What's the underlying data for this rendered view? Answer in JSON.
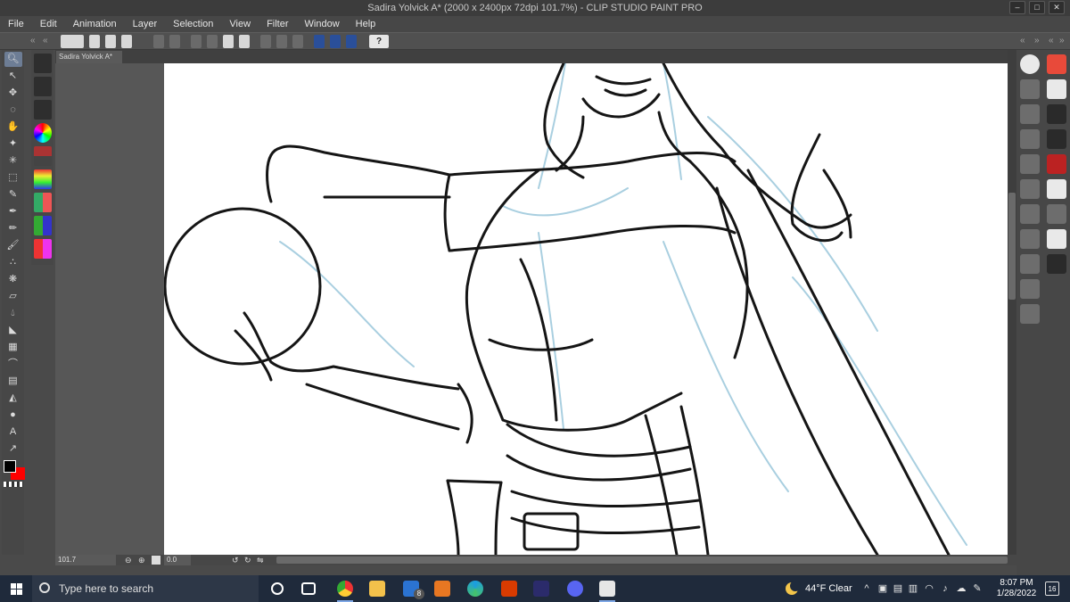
{
  "window": {
    "title": "Sadira Yolvick A* (2000 x 2400px 72dpi 101.7%)  - CLIP STUDIO PAINT PRO",
    "controls": [
      "minimize-icon",
      "maximize-icon",
      "close-icon"
    ]
  },
  "menu": {
    "items": [
      {
        "label": "File"
      },
      {
        "label": "Edit"
      },
      {
        "label": "Animation"
      },
      {
        "label": "Layer"
      },
      {
        "label": "Selection"
      },
      {
        "label": "View"
      },
      {
        "label": "Filter"
      },
      {
        "label": "Window"
      },
      {
        "label": "Help"
      }
    ]
  },
  "command_bar": {
    "help_label": "?"
  },
  "document": {
    "tab_label": "Sadira Yolvick A*"
  },
  "status": {
    "zoom": "101.7",
    "rotation": "0.0"
  },
  "tools": {
    "active": "zoom",
    "main_color": "#000000",
    "sub_color": "#ff0000"
  },
  "taskbar": {
    "search_placeholder": "Type here to search",
    "mail_badge": "8",
    "weather": "44°F  Clear",
    "time": "8:07 PM",
    "date": "1/28/2022",
    "notifications": "16"
  }
}
